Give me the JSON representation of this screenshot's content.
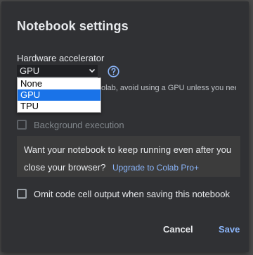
{
  "dialog": {
    "title": "Notebook settings"
  },
  "hardware": {
    "label": "Hardware accelerator",
    "selected": "GPU",
    "options": [
      "None",
      "GPU",
      "TPU"
    ],
    "note_visible": "olab, avoid using a GPU unless you need"
  },
  "background_execution": {
    "label": "Background execution",
    "checked": false
  },
  "promo": {
    "text_line1": "Want your notebook to keep running even after you",
    "text_line2": "close your browser?",
    "link": "Upgrade to Colab Pro+"
  },
  "omit_output": {
    "label": "Omit code cell output when saving this notebook",
    "checked": false
  },
  "buttons": {
    "cancel": "Cancel",
    "save": "Save"
  },
  "colors": {
    "accent": "#8ab4f8",
    "dialog_bg": "#303134",
    "selection": "#1a73e8"
  },
  "icons": {
    "help": "help-circle-icon",
    "dropdown": "chevron-down-icon"
  }
}
